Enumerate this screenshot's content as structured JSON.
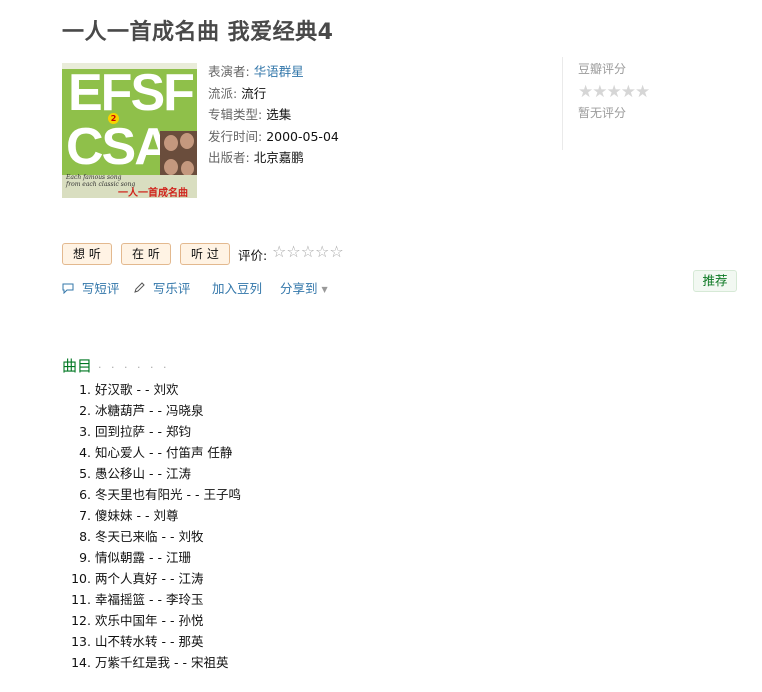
{
  "album": {
    "title": "一人一首成名曲 我爱经典4",
    "cover": {
      "letters_line1": "EFSF",
      "letters_line2": "CSA",
      "disc_number": "2",
      "english_text": "Each famous song from each classic song",
      "chinese_text": "一人一首成名曲"
    }
  },
  "info": {
    "performer_label": "表演者:",
    "performer": "华语群星",
    "genre_label": "流派:",
    "genre": "流行",
    "type_label": "专辑类型:",
    "type": "选集",
    "release_label": "发行时间:",
    "release": "2000-05-04",
    "publisher_label": "出版者:",
    "publisher": "北京嘉鹏"
  },
  "rating": {
    "title": "豆瓣评分",
    "stars": "★★★★★",
    "none_text": "暂无评分"
  },
  "actions": {
    "want_label": "想 听",
    "doing_label": "在 听",
    "done_label": "听 过",
    "rate_label": "评价:",
    "my_stars": "☆☆☆☆☆",
    "short_review_icon": "speech-bubble-icon",
    "short_review": "写短评",
    "review_icon": "pencil-icon",
    "review": "写乐评",
    "doulist": "加入豆列",
    "share": "分享到",
    "share_arrow": "▼",
    "recommend": "推荐"
  },
  "tracklist": {
    "heading": "曲目",
    "dots": "· · · · · ·",
    "items": [
      {
        "n": "1.",
        "t": "好汉歌 - - 刘欢"
      },
      {
        "n": "2.",
        "t": "冰糖葫芦 - - 冯晓泉"
      },
      {
        "n": "3.",
        "t": "回到拉萨 - - 郑钧"
      },
      {
        "n": "4.",
        "t": "知心爱人 - - 付笛声 任静"
      },
      {
        "n": "5.",
        "t": "愚公移山 - - 江涛"
      },
      {
        "n": "6.",
        "t": "冬天里也有阳光 - - 王子鸣"
      },
      {
        "n": "7.",
        "t": "傻妹妹 - - 刘尊"
      },
      {
        "n": "8.",
        "t": "冬天已来临 - - 刘牧"
      },
      {
        "n": "9.",
        "t": "情似朝露 - - 江珊"
      },
      {
        "n": "10.",
        "t": "两个人真好 - - 江涛"
      },
      {
        "n": "11.",
        "t": "幸福摇篮 - - 李玲玉"
      },
      {
        "n": "12.",
        "t": "欢乐中国年 - - 孙悦"
      },
      {
        "n": "13.",
        "t": "山不转水转 - - 那英"
      },
      {
        "n": "14.",
        "t": "万紫千红是我 - - 宋祖英"
      }
    ]
  }
}
